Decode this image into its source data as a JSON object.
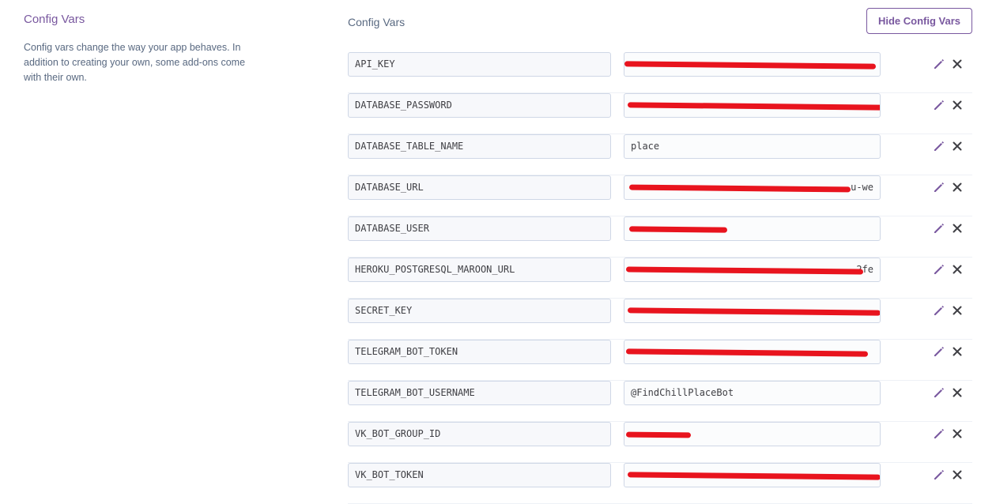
{
  "sidebar": {
    "title": "Config Vars",
    "description": "Config vars change the way your app behaves. In addition to creating your own, some add-ons come with their own."
  },
  "main": {
    "title": "Config Vars",
    "hide_button_label": "Hide Config Vars"
  },
  "colors": {
    "accent": "#79589f",
    "redaction": "#e8141e",
    "icon": "#79589f",
    "delete_icon": "#3f3f44"
  },
  "vars": [
    {
      "key": "API_KEY",
      "value": "",
      "redacted": true
    },
    {
      "key": "DATABASE_PASSWORD",
      "value": "",
      "redacted": true
    },
    {
      "key": "DATABASE_TABLE_NAME",
      "value": "place",
      "redacted": false
    },
    {
      "key": "DATABASE_URL",
      "value": "u-we",
      "redacted": true
    },
    {
      "key": "DATABASE_USER",
      "value": "",
      "redacted": true
    },
    {
      "key": "HEROKU_POSTGRESQL_MAROON_URL",
      "value": "2fe",
      "redacted": true
    },
    {
      "key": "SECRET_KEY",
      "value": "",
      "redacted": true
    },
    {
      "key": "TELEGRAM_BOT_TOKEN",
      "value": "",
      "redacted": true
    },
    {
      "key": "TELEGRAM_BOT_USERNAME",
      "value": "@FindChillPlaceBot",
      "redacted": false
    },
    {
      "key": "VK_BOT_GROUP_ID",
      "value": "",
      "redacted": true
    },
    {
      "key": "VK_BOT_TOKEN",
      "value": "",
      "redacted": true
    }
  ],
  "icons": {
    "edit": "pencil-icon",
    "delete": "close-icon"
  }
}
